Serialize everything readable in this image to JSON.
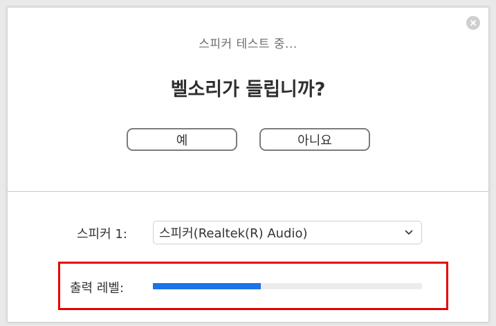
{
  "dialog": {
    "status_text": "스피커 테스트 중...",
    "question": "벨소리가 들립니까?",
    "yes_label": "예",
    "no_label": "아니요",
    "close_icon": "close-icon"
  },
  "speaker": {
    "label": "스피커 1:",
    "selected": "스피커(Realtek(R) Audio)",
    "dropdown_icon": "chevron-down-icon"
  },
  "output_level": {
    "label": "출력 레벨:",
    "level_fraction": 0.4,
    "fill_color": "#1a73e8",
    "track_color": "#ececec"
  },
  "annotation": {
    "highlight_color": "#e60000"
  }
}
